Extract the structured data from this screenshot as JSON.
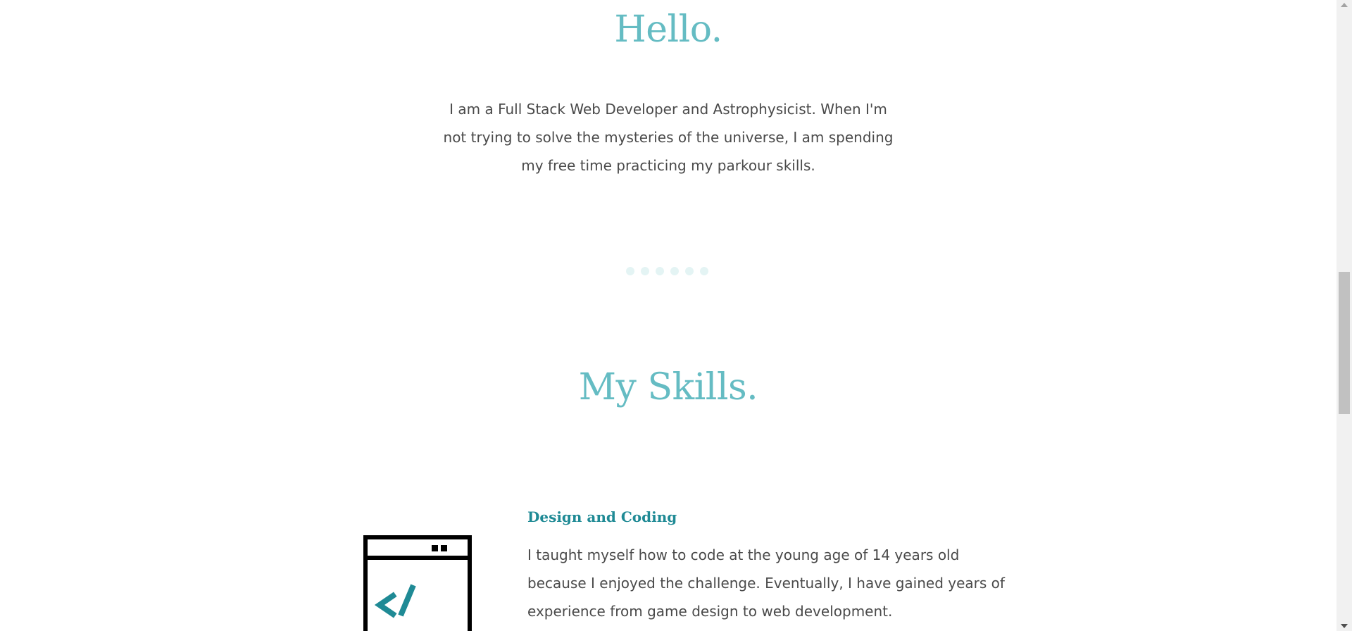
{
  "hello": {
    "title": "Hello.",
    "intro": "I am a Full Stack Web Developer and Astrophysicist. When I'm not trying to solve the mysteries of the universe, I am spending my free time practicing my parkour skills."
  },
  "carousel": {
    "dot_count": 6,
    "dot_color": "#e4f4f4"
  },
  "skills": {
    "title": "My Skills.",
    "items": [
      {
        "icon": "code-window-icon",
        "title": "Design and Coding",
        "text": "I taught myself how to code at the young age of 14 years old because I enjoyed the challenge. Eventually, I have gained years of experience from game design to web development."
      }
    ]
  },
  "colors": {
    "heading": "#65bcc3",
    "accent": "#1f8a95",
    "text": "#4a4a4a"
  }
}
